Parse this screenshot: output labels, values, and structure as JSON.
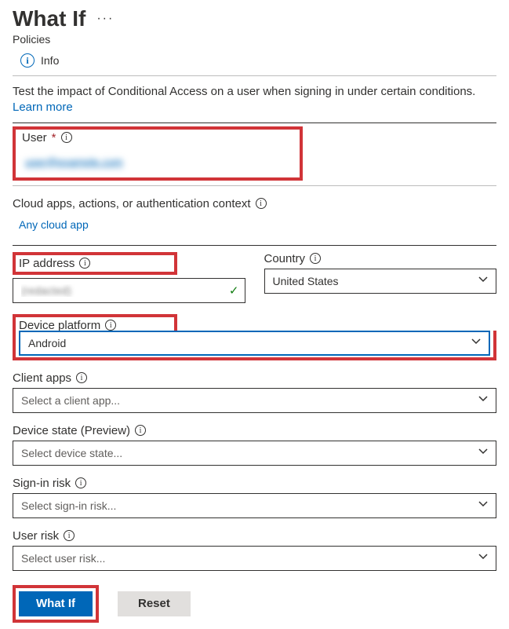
{
  "header": {
    "title": "What If",
    "subtitle": "Policies",
    "info_label": "Info"
  },
  "description": {
    "text": "Test the impact of Conditional Access on a user when signing in under certain conditions. ",
    "learn_more": "Learn more"
  },
  "user": {
    "label": "User",
    "value": "user@example.com"
  },
  "cloud_apps": {
    "label": "Cloud apps, actions, or authentication context",
    "link": "Any cloud app"
  },
  "ip": {
    "label": "IP address",
    "value": "(redacted)"
  },
  "country": {
    "label": "Country",
    "value": "United States"
  },
  "device_platform": {
    "label": "Device platform",
    "value": "Android"
  },
  "client_apps": {
    "label": "Client apps",
    "placeholder": "Select a client app..."
  },
  "device_state": {
    "label": "Device state (Preview)",
    "placeholder": "Select device state..."
  },
  "signin_risk": {
    "label": "Sign-in risk",
    "placeholder": "Select sign-in risk..."
  },
  "user_risk": {
    "label": "User risk",
    "placeholder": "Select user risk..."
  },
  "buttons": {
    "whatif": "What If",
    "reset": "Reset"
  }
}
